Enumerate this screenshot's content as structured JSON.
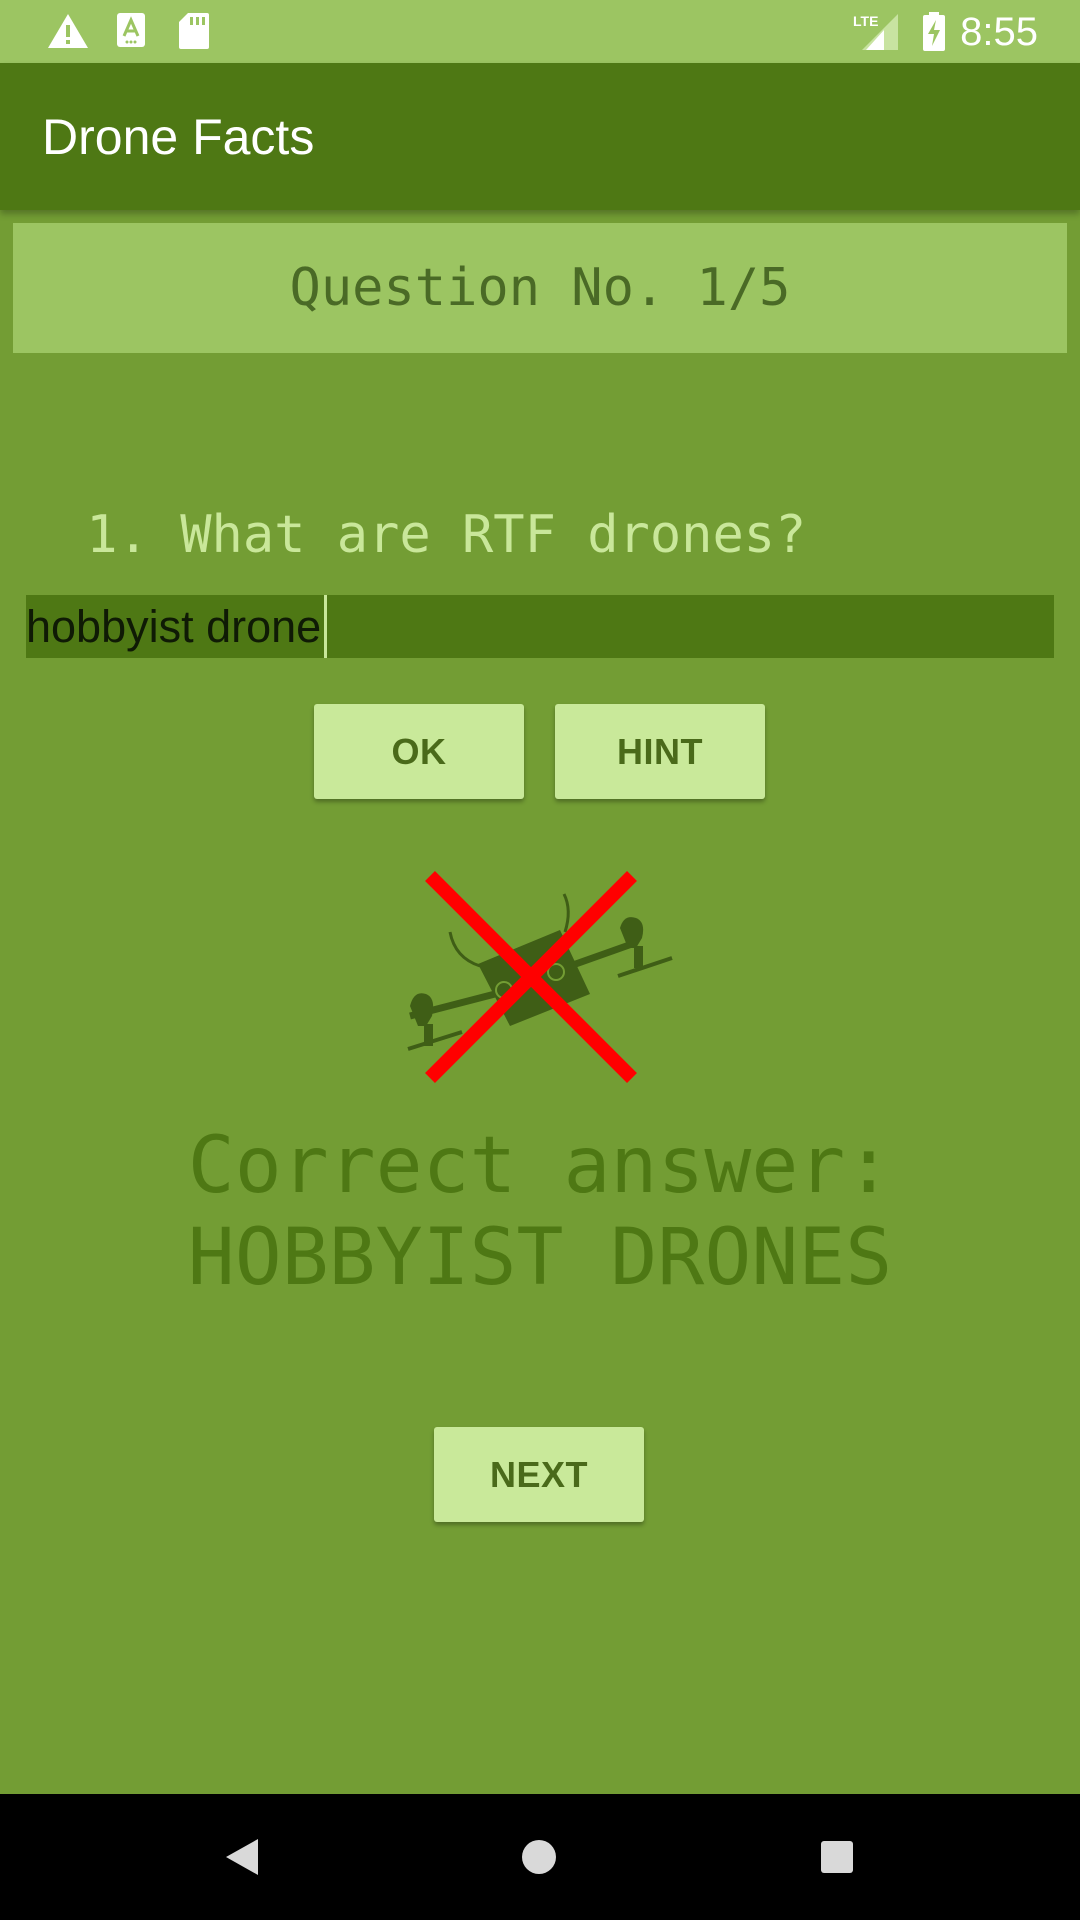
{
  "status_bar": {
    "time": "8:55",
    "icons": [
      "warning-icon",
      "text-input-icon",
      "sd-card-icon",
      "lte-signal-icon",
      "battery-charging-icon"
    ],
    "network_label": "LTE"
  },
  "app_bar": {
    "title": "Drone Facts"
  },
  "quiz": {
    "question_number": "Question No. 1/5",
    "question_text": " 1. What are RTF drones?",
    "answer_value": "hobbyist drone",
    "ok_label": "OK",
    "hint_label": "HINT",
    "result_icon": "drone-with-red-x-icon",
    "correct_line1": "Correct answer:",
    "correct_line2": "HOBBYIST DRONES",
    "next_label": "NEXT"
  },
  "nav_bar": {
    "icons": [
      "back-icon",
      "home-icon",
      "recents-icon"
    ]
  },
  "colors": {
    "background": "#739d34",
    "status_bar": "#9cc562",
    "app_bar": "#4e7814",
    "button": "#c9e99a",
    "wrong_mark": "#ff0000"
  }
}
